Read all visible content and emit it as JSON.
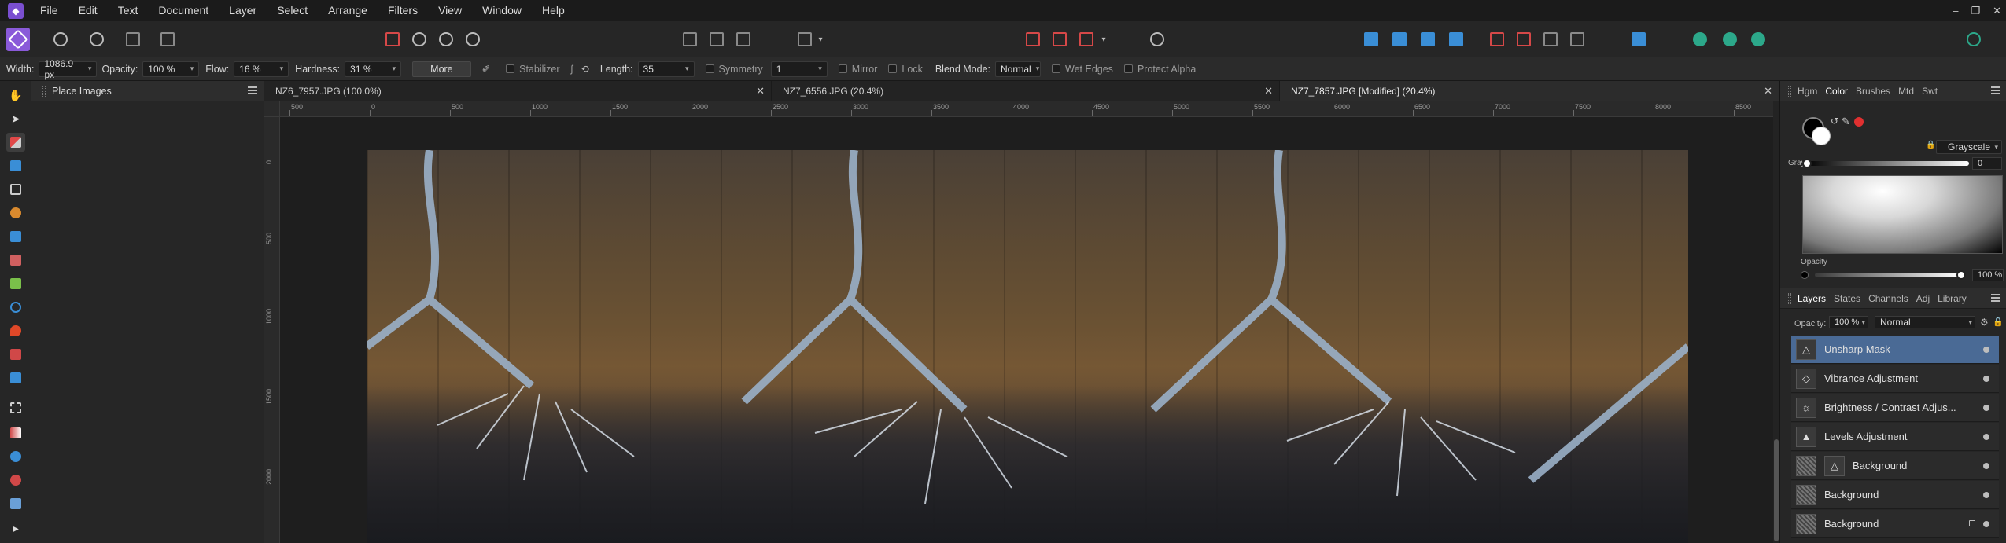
{
  "menu": {
    "items": [
      "File",
      "Edit",
      "Text",
      "Document",
      "Layer",
      "Select",
      "Arrange",
      "Filters",
      "View",
      "Window",
      "Help"
    ],
    "window_controls": [
      "–",
      "❐",
      "✕"
    ]
  },
  "context": {
    "width_label": "Width:",
    "width_value": "1086.9 px",
    "opacity_label": "Opacity:",
    "opacity_value": "100 %",
    "flow_label": "Flow:",
    "flow_value": "16 %",
    "hardness_label": "Hardness:",
    "hardness_value": "31 %",
    "more_label": "More",
    "stabilizer_label": "Stabilizer",
    "length_label": "Length:",
    "length_value": "35",
    "symmetry_label": "Symmetry",
    "symmetry_value": "1",
    "mirror_label": "Mirror",
    "lock_label": "Lock",
    "blend_label": "Blend Mode:",
    "blend_value": "Normal",
    "wet_edges_label": "Wet Edges",
    "protect_alpha_label": "Protect Alpha"
  },
  "place_panel": {
    "title": "Place Images"
  },
  "tabs": [
    {
      "label": "NZ6_7957.JPG (100.0%)"
    },
    {
      "label": "NZ7_6556.JPG (20.4%)"
    },
    {
      "label": "NZ7_7857.JPG [Modified] (20.4%)"
    }
  ],
  "ruler_h": [
    "500",
    "0",
    "500",
    "1000",
    "1500",
    "2000",
    "2500",
    "3000",
    "3500",
    "4000",
    "4500",
    "5000",
    "5500",
    "6000",
    "6500",
    "7000",
    "7500",
    "8000",
    "8500"
  ],
  "ruler_v": [
    "0",
    "500",
    "1000",
    "1500",
    "2000"
  ],
  "color_panel": {
    "tabs": [
      "Hgm",
      "Color",
      "Brushes",
      "Mtd",
      "Swt"
    ],
    "mode": "Grayscale",
    "gray_label": "Gray:",
    "gray_value": "0",
    "opacity_label": "Opacity",
    "opacity_value": "100 %"
  },
  "layers_panel": {
    "tabs": [
      "Layers",
      "States",
      "Channels",
      "Adj",
      "Library"
    ],
    "opacity_label": "Opacity:",
    "opacity_value": "100 %",
    "blend_value": "Normal",
    "layers": [
      {
        "name": "Unsharp Mask",
        "selected": true
      },
      {
        "name": "Vibrance Adjustment"
      },
      {
        "name": "Brightness / Contrast Adjus..."
      },
      {
        "name": "Levels Adjustment"
      },
      {
        "name": "Background"
      },
      {
        "name": "Background"
      },
      {
        "name": "Background"
      }
    ]
  },
  "colors": {
    "accent": "#8a5ad9",
    "selection": "#4a6a95",
    "brush_red": "#e03030"
  }
}
